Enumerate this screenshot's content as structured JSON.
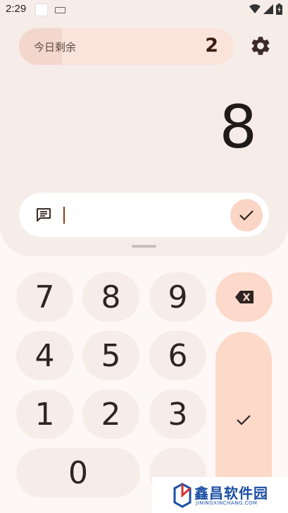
{
  "status_bar": {
    "time": "2:29",
    "icons": [
      "app-notification-icon",
      "keyboard-icon",
      "wifi-icon",
      "signal-icon",
      "battery-icon"
    ]
  },
  "counter": {
    "label": "今日剩余",
    "value": "2",
    "progress_fraction": 0.2
  },
  "display": {
    "value": "8"
  },
  "note_input": {
    "value": "",
    "placeholder": ""
  },
  "keypad": {
    "keys": [
      "7",
      "8",
      "9",
      "4",
      "5",
      "6",
      "1",
      "2",
      "3",
      "0"
    ],
    "icons": [
      "backspace-icon",
      "checkmark-icon"
    ]
  },
  "watermark": {
    "text": "鑫昌软件园",
    "subtext": "JININGXINCHANG.COM"
  },
  "colors": {
    "panel_bg": "#f6ece8",
    "page_bg": "#fdf8f6",
    "accent_peach": "#fdd9ca",
    "text_dark": "#201a18",
    "counter_value": "#3b1d12"
  }
}
